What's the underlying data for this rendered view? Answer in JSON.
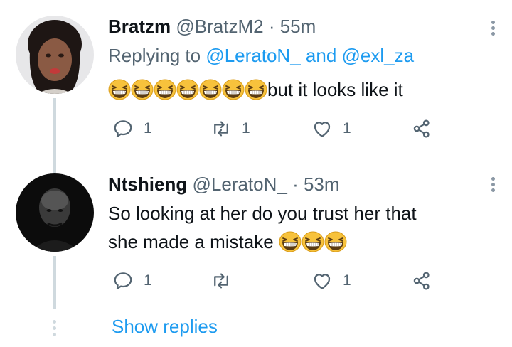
{
  "tweets": [
    {
      "name": "Bratzm",
      "handle": "@BratzM2",
      "sep": "·",
      "time": "55m",
      "replying_prefix": "Replying to",
      "mention1": "@LeratoN_",
      "and_text": "and",
      "mention2": "@exl_za",
      "text_after_emoji": "but it looks like it",
      "emoji_count": 7,
      "replies": "1",
      "retweets": "1",
      "likes": "1"
    },
    {
      "name": "Ntshieng",
      "handle": "@LeratoN_",
      "sep": "·",
      "time": "53m",
      "line1": "So looking at her do you trust her that",
      "line2": "she made a mistake",
      "emoji_count": 3,
      "replies": "1",
      "retweets": "",
      "likes": "1"
    }
  ],
  "show_replies": "Show replies",
  "colors": {
    "link": "#1d9bf0",
    "secondary": "#536471",
    "thread": "#cfd9de"
  },
  "icons": [
    "reply-icon",
    "retweet-icon",
    "like-icon",
    "share-icon",
    "more-icon",
    "grinning-squinting-emoji"
  ]
}
